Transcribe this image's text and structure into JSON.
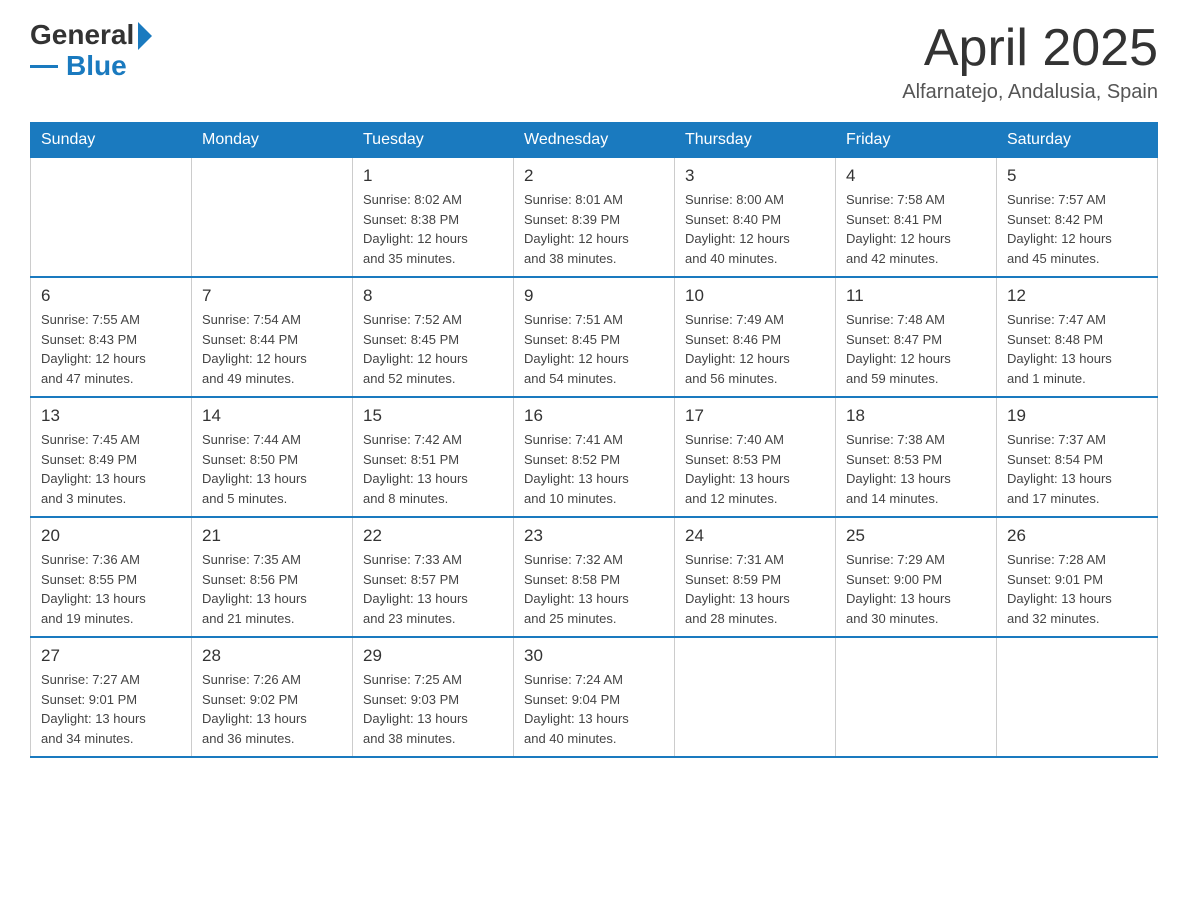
{
  "header": {
    "logo_general": "General",
    "logo_blue": "Blue",
    "title": "April 2025",
    "subtitle": "Alfarnatejo, Andalusia, Spain"
  },
  "weekdays": [
    "Sunday",
    "Monday",
    "Tuesday",
    "Wednesday",
    "Thursday",
    "Friday",
    "Saturday"
  ],
  "weeks": [
    [
      {
        "day": "",
        "info": ""
      },
      {
        "day": "",
        "info": ""
      },
      {
        "day": "1",
        "info": "Sunrise: 8:02 AM\nSunset: 8:38 PM\nDaylight: 12 hours\nand 35 minutes."
      },
      {
        "day": "2",
        "info": "Sunrise: 8:01 AM\nSunset: 8:39 PM\nDaylight: 12 hours\nand 38 minutes."
      },
      {
        "day": "3",
        "info": "Sunrise: 8:00 AM\nSunset: 8:40 PM\nDaylight: 12 hours\nand 40 minutes."
      },
      {
        "day": "4",
        "info": "Sunrise: 7:58 AM\nSunset: 8:41 PM\nDaylight: 12 hours\nand 42 minutes."
      },
      {
        "day": "5",
        "info": "Sunrise: 7:57 AM\nSunset: 8:42 PM\nDaylight: 12 hours\nand 45 minutes."
      }
    ],
    [
      {
        "day": "6",
        "info": "Sunrise: 7:55 AM\nSunset: 8:43 PM\nDaylight: 12 hours\nand 47 minutes."
      },
      {
        "day": "7",
        "info": "Sunrise: 7:54 AM\nSunset: 8:44 PM\nDaylight: 12 hours\nand 49 minutes."
      },
      {
        "day": "8",
        "info": "Sunrise: 7:52 AM\nSunset: 8:45 PM\nDaylight: 12 hours\nand 52 minutes."
      },
      {
        "day": "9",
        "info": "Sunrise: 7:51 AM\nSunset: 8:45 PM\nDaylight: 12 hours\nand 54 minutes."
      },
      {
        "day": "10",
        "info": "Sunrise: 7:49 AM\nSunset: 8:46 PM\nDaylight: 12 hours\nand 56 minutes."
      },
      {
        "day": "11",
        "info": "Sunrise: 7:48 AM\nSunset: 8:47 PM\nDaylight: 12 hours\nand 59 minutes."
      },
      {
        "day": "12",
        "info": "Sunrise: 7:47 AM\nSunset: 8:48 PM\nDaylight: 13 hours\nand 1 minute."
      }
    ],
    [
      {
        "day": "13",
        "info": "Sunrise: 7:45 AM\nSunset: 8:49 PM\nDaylight: 13 hours\nand 3 minutes."
      },
      {
        "day": "14",
        "info": "Sunrise: 7:44 AM\nSunset: 8:50 PM\nDaylight: 13 hours\nand 5 minutes."
      },
      {
        "day": "15",
        "info": "Sunrise: 7:42 AM\nSunset: 8:51 PM\nDaylight: 13 hours\nand 8 minutes."
      },
      {
        "day": "16",
        "info": "Sunrise: 7:41 AM\nSunset: 8:52 PM\nDaylight: 13 hours\nand 10 minutes."
      },
      {
        "day": "17",
        "info": "Sunrise: 7:40 AM\nSunset: 8:53 PM\nDaylight: 13 hours\nand 12 minutes."
      },
      {
        "day": "18",
        "info": "Sunrise: 7:38 AM\nSunset: 8:53 PM\nDaylight: 13 hours\nand 14 minutes."
      },
      {
        "day": "19",
        "info": "Sunrise: 7:37 AM\nSunset: 8:54 PM\nDaylight: 13 hours\nand 17 minutes."
      }
    ],
    [
      {
        "day": "20",
        "info": "Sunrise: 7:36 AM\nSunset: 8:55 PM\nDaylight: 13 hours\nand 19 minutes."
      },
      {
        "day": "21",
        "info": "Sunrise: 7:35 AM\nSunset: 8:56 PM\nDaylight: 13 hours\nand 21 minutes."
      },
      {
        "day": "22",
        "info": "Sunrise: 7:33 AM\nSunset: 8:57 PM\nDaylight: 13 hours\nand 23 minutes."
      },
      {
        "day": "23",
        "info": "Sunrise: 7:32 AM\nSunset: 8:58 PM\nDaylight: 13 hours\nand 25 minutes."
      },
      {
        "day": "24",
        "info": "Sunrise: 7:31 AM\nSunset: 8:59 PM\nDaylight: 13 hours\nand 28 minutes."
      },
      {
        "day": "25",
        "info": "Sunrise: 7:29 AM\nSunset: 9:00 PM\nDaylight: 13 hours\nand 30 minutes."
      },
      {
        "day": "26",
        "info": "Sunrise: 7:28 AM\nSunset: 9:01 PM\nDaylight: 13 hours\nand 32 minutes."
      }
    ],
    [
      {
        "day": "27",
        "info": "Sunrise: 7:27 AM\nSunset: 9:01 PM\nDaylight: 13 hours\nand 34 minutes."
      },
      {
        "day": "28",
        "info": "Sunrise: 7:26 AM\nSunset: 9:02 PM\nDaylight: 13 hours\nand 36 minutes."
      },
      {
        "day": "29",
        "info": "Sunrise: 7:25 AM\nSunset: 9:03 PM\nDaylight: 13 hours\nand 38 minutes."
      },
      {
        "day": "30",
        "info": "Sunrise: 7:24 AM\nSunset: 9:04 PM\nDaylight: 13 hours\nand 40 minutes."
      },
      {
        "day": "",
        "info": ""
      },
      {
        "day": "",
        "info": ""
      },
      {
        "day": "",
        "info": ""
      }
    ]
  ]
}
